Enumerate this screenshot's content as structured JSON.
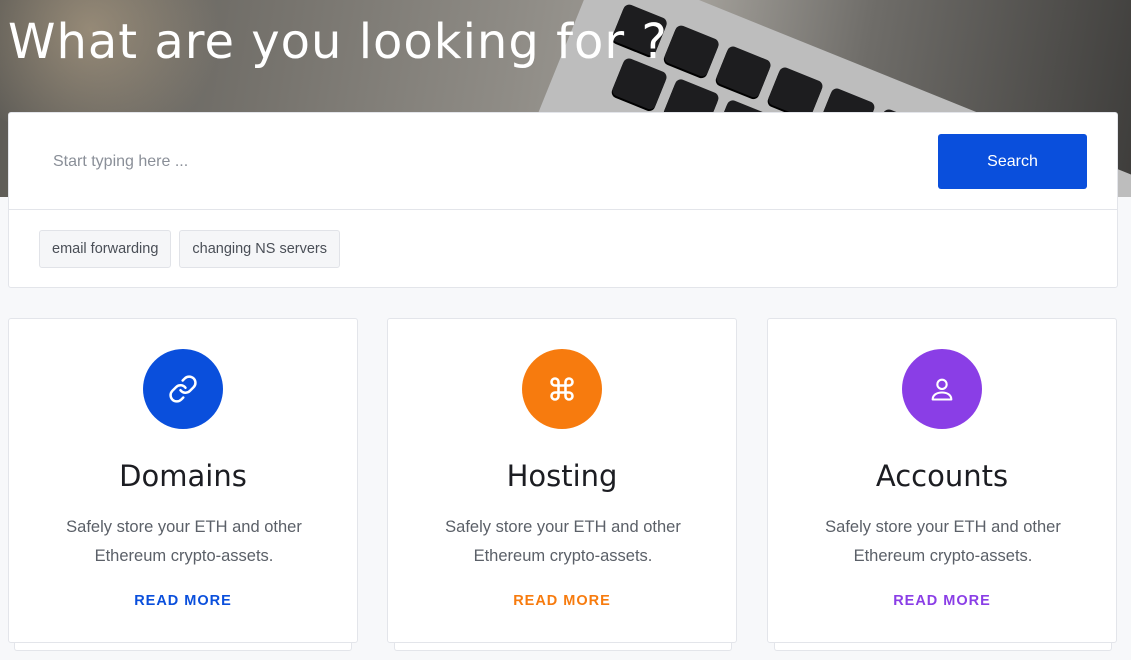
{
  "hero": {
    "title": "What are you looking for ?"
  },
  "search": {
    "placeholder": "Start typing here ...",
    "value": "",
    "button_label": "Search",
    "tags": [
      "email forwarding",
      "changing NS servers"
    ]
  },
  "cards": [
    {
      "title": "Domains",
      "description": "Safely store your ETH and other Ethereum crypto-assets.",
      "link_label": "READ MORE",
      "icon": "link-icon",
      "color": "#0a4fdc"
    },
    {
      "title": "Hosting",
      "description": "Safely store your ETH and other Ethereum crypto-assets.",
      "link_label": "READ MORE",
      "icon": "command-icon",
      "color": "#f77b0e"
    },
    {
      "title": "Accounts",
      "description": "Safely store your ETH and other Ethereum crypto-assets.",
      "link_label": "READ MORE",
      "icon": "user-icon",
      "color": "#8a3ee6"
    }
  ]
}
